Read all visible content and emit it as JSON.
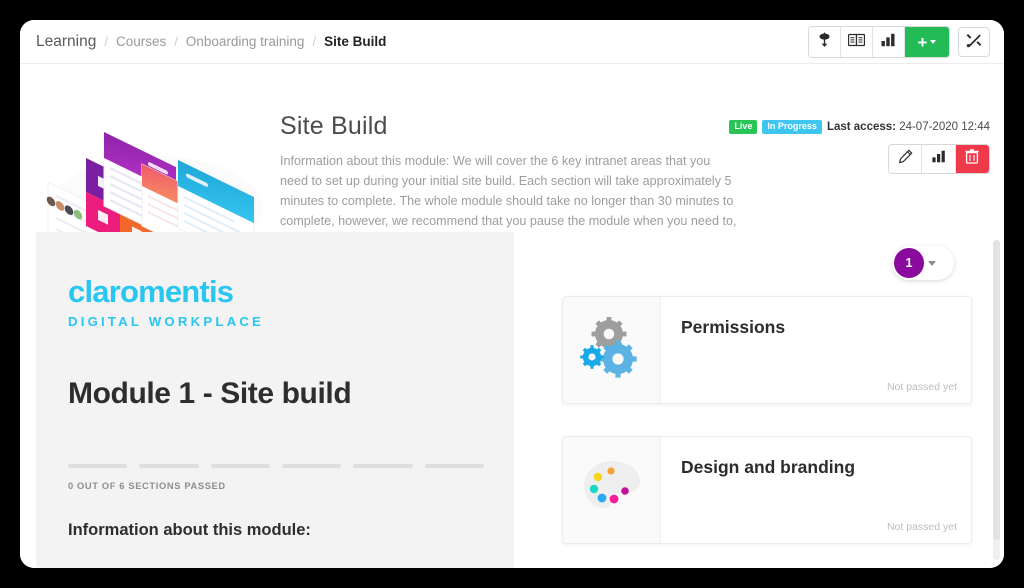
{
  "breadcrumb": {
    "root": "Learning",
    "items": [
      "Courses",
      "Onboarding training"
    ],
    "current": "Site Build",
    "separator": "/"
  },
  "toolbar": {
    "buttons": [
      {
        "name": "certificate-icon",
        "label": "Certificates"
      },
      {
        "name": "book-icon",
        "label": "Catalogue"
      },
      {
        "name": "bar-chart-icon",
        "label": "Reports"
      }
    ],
    "add_label": "+",
    "tools_label": "Tools"
  },
  "hero": {
    "title": "Site Build",
    "description": "Information about this module: We will cover the 6 key intranet areas that you need to set up during your initial site build.  Each section will take approximately 5 minutes to complete.  The whole module should take no longer than 30 minutes to complete, however, we recommend that you pause the module when you need to, and take the time to apply the steps you have learnt.  After each section is a short quiz.",
    "badges": [
      {
        "label": "Live",
        "color": "#28c456"
      },
      {
        "label": "In Progress",
        "color": "#3ec6f0"
      }
    ],
    "last_access_label": "Last access:",
    "last_access_value": "24-07-2020 12:44",
    "actions": [
      {
        "name": "edit-button",
        "label": "Edit"
      },
      {
        "name": "stats-button",
        "label": "Statistics"
      },
      {
        "name": "delete-button",
        "label": "Delete",
        "color": "#f03a4b"
      }
    ]
  },
  "slide": {
    "logo_word": "claromentis",
    "logo_sub": "DIGITAL WORKPLACE",
    "module_title": "Module 1 - Site build",
    "progress": {
      "total_segments": 6,
      "passed": 0,
      "label": "0 OUT OF 6 SECTIONS PASSED"
    },
    "info_heading": "Information about this module:"
  },
  "pager": {
    "current_page": "1"
  },
  "sections": [
    {
      "title": "Permissions",
      "status": "Not passed yet",
      "icon": "gears-icon"
    },
    {
      "title": "Design and branding",
      "status": "Not passed yet",
      "icon": "palette-icon"
    }
  ]
}
